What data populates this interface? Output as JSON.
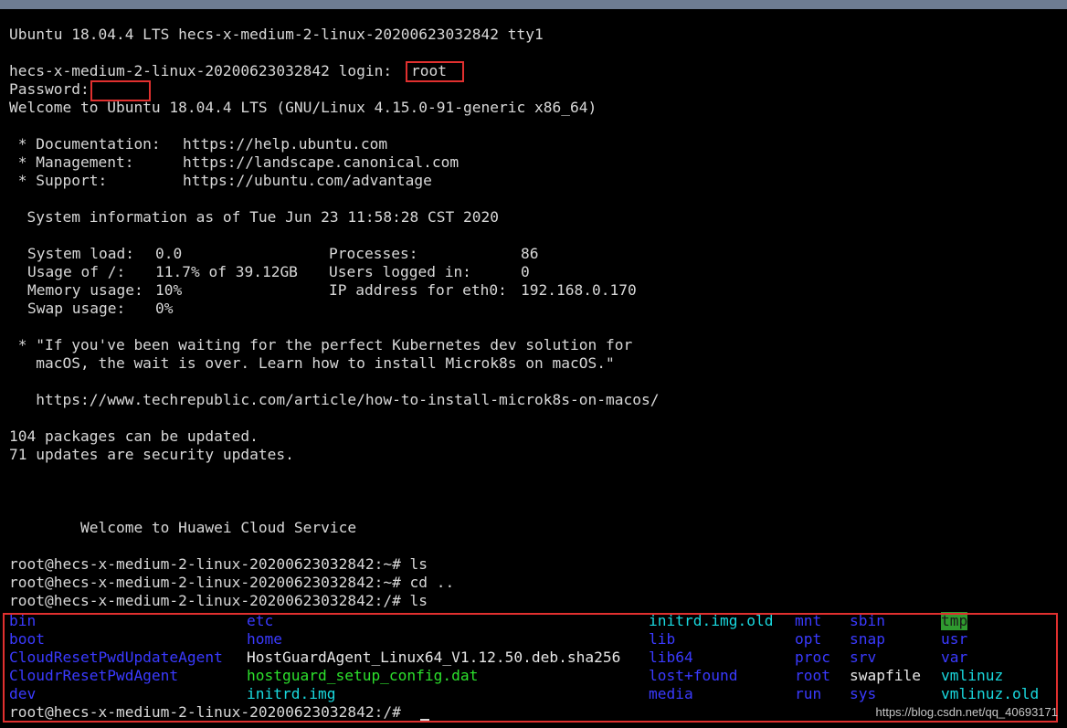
{
  "terminal": {
    "banner": "Ubuntu 18.04.4 LTS hecs-x-medium-2-linux-20200623032842 tty1",
    "login_prompt": "hecs-x-medium-2-linux-20200623032842 login:",
    "login_value": "root",
    "password_prompt": "Password:",
    "welcome": "Welcome to Ubuntu 18.04.4 LTS (GNU/Linux 4.15.0-91-generic x86_64)",
    "links": [
      {
        "label": " * Documentation:",
        "url": "https://help.ubuntu.com"
      },
      {
        "label": " * Management:",
        "url": "https://landscape.canonical.com"
      },
      {
        "label": " * Support:",
        "url": "https://ubuntu.com/advantage"
      }
    ],
    "sysinfo_header": "  System information as of Tue Jun 23 11:58:28 CST 2020",
    "sysinfo": [
      {
        "left_label": "System load:",
        "left_value": "0.0",
        "right_label": "Processes:",
        "right_value": "86"
      },
      {
        "left_label": "Usage of /:",
        "left_value": "11.7% of 39.12GB",
        "right_label": "Users logged in:",
        "right_value": "0"
      },
      {
        "left_label": "Memory usage:",
        "left_value": "10%",
        "right_label": "IP address for eth0:",
        "right_value": "192.168.0.170"
      },
      {
        "left_label": "Swap usage:",
        "left_value": "0%",
        "right_label": "",
        "right_value": ""
      }
    ],
    "motd_lines": [
      " * \"If you've been waiting for the perfect Kubernetes dev solution for",
      "   macOS, the wait is over. Learn how to install Microk8s on macOS.\"",
      "   https://www.techrepublic.com/article/how-to-install-microk8s-on-macos/"
    ],
    "updates": [
      "104 packages can be updated.",
      "71 updates are security updates."
    ],
    "cloud_welcome": "        Welcome to Huawei Cloud Service",
    "commands": [
      "root@hecs-x-medium-2-linux-20200623032842:~# ls",
      "root@hecs-x-medium-2-linux-20200623032842:~# cd ..",
      "root@hecs-x-medium-2-linux-20200623032842:/# ls"
    ],
    "ls_rows": [
      [
        "bin",
        "etc",
        "initrd.img.old",
        "mnt",
        "sbin",
        "tmp"
      ],
      [
        "boot",
        "home",
        "lib",
        "opt",
        "snap",
        "usr"
      ],
      [
        "CloudResetPwdUpdateAgent",
        "HostGuardAgent_Linux64_V1.12.50.deb.sha256",
        "lib64",
        "proc",
        "srv",
        "var"
      ],
      [
        "CloudrResetPwdAgent",
        "hostguard_setup_config.dat",
        "lost+found",
        "root",
        "swapfile",
        "vmlinuz"
      ],
      [
        "dev",
        "initrd.img",
        "media",
        "run",
        "sys",
        "vmlinuz.old"
      ]
    ],
    "final_prompt": "root@hecs-x-medium-2-linux-20200623032842:/# "
  },
  "colors": {
    "directory": "#3a3aff",
    "symlink": "#19d8de",
    "executable": "#2ce02c",
    "regular": "#e6e6e6",
    "highlight_box": "#e0302f"
  },
  "watermark": "https://blog.csdn.net/qq_40693171"
}
